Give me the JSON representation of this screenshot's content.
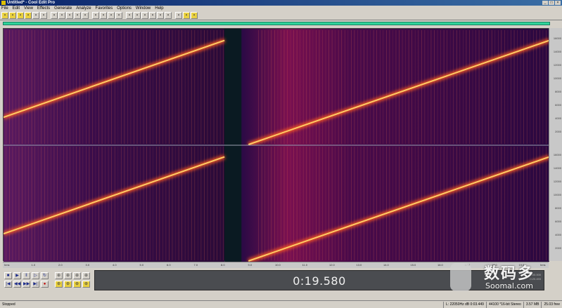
{
  "window": {
    "title": "Untitled* - Cool Edit Pro"
  },
  "menu": [
    "File",
    "Edit",
    "View",
    "Effects",
    "Generate",
    "Analyze",
    "Favorites",
    "Options",
    "Window",
    "Help"
  ],
  "toolbar": {
    "icons": [
      "new-file-icon",
      "open-icon",
      "close-icon",
      "save-icon",
      "record-icon",
      "mix-icon",
      "cut-icon",
      "copy-icon",
      "paste-icon",
      "undo-icon",
      "redo-icon",
      "select-icon",
      "spectral-icon",
      "waveform-icon",
      "multitrack-icon",
      "zoom-icon",
      "cue-icon",
      "loop-icon",
      "marker-icon",
      "snap-icon",
      "grid-icon",
      "view-icon",
      "settings-icon",
      "edit-icon"
    ]
  },
  "spectrogram": {
    "channels": 2,
    "sweep1": {
      "start_time": 0.0,
      "end_time": 8.3
    },
    "silence": {
      "start_time": 8.3,
      "end_time": 9.2
    },
    "sweep2": {
      "start_time": 9.2,
      "end_time": 20.5
    },
    "colors": {
      "background": "#2a0a3a",
      "sweep": "#ffcc66",
      "glow": "#ff5a20"
    }
  },
  "vruler": {
    "labels": [
      "16000",
      "14000",
      "12000",
      "10000",
      "8000",
      "6000",
      "4000",
      "2000"
    ]
  },
  "hruler": {
    "labels": [
      "hms",
      "1.0",
      "2.0",
      "3.0",
      "4.0",
      "5.0",
      "6.0",
      "7.0",
      "8.0",
      "9.0",
      "10.0",
      "11.0",
      "12.0",
      "13.0",
      "14.0",
      "15.0",
      "16.0",
      "17.0",
      "18.0",
      "19.0",
      "hms"
    ]
  },
  "transport": {
    "buttons": [
      "stop",
      "play",
      "pause",
      "play-to-end",
      "loop",
      "go-start",
      "rewind",
      "fast-forward",
      "go-end",
      "record"
    ]
  },
  "zoom": {
    "buttons": [
      "zoom-in-h",
      "zoom-out-h",
      "zoom-full",
      "zoom-sel",
      "zoom-in-v",
      "zoom-out-v",
      "zoom-left",
      "zoom-right"
    ]
  },
  "time": {
    "display": "0:19.580",
    "side_values": [
      "0:00.000",
      "0:20.493"
    ]
  },
  "status": {
    "state": "Stopped",
    "items": [
      "L: 22050Hz dB  0:03.449",
      "44100 *16-bit Stereo",
      "3.57 MB",
      "25.03 free"
    ]
  },
  "watermark": {
    "brand_cn": "数码多",
    "brand_en": "Soomal.com"
  }
}
